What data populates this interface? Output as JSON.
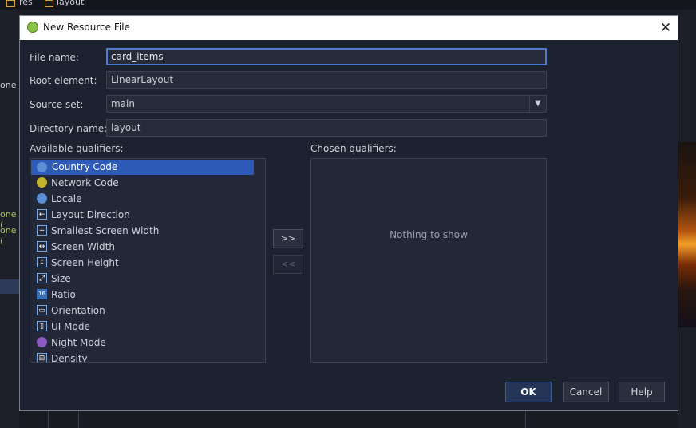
{
  "ide": {
    "breadcrumb": [
      "res",
      "layout"
    ],
    "left_fragments": [
      "one",
      "one (",
      "one ("
    ]
  },
  "dialog": {
    "title": "New Resource File",
    "close_glyph": "✕",
    "fields": {
      "file_name": {
        "label": "File name:",
        "value": "card_items"
      },
      "root_element": {
        "label": "Root element:",
        "value": "LinearLayout"
      },
      "source_set": {
        "label": "Source set:",
        "value": "main"
      },
      "directory_name": {
        "label": "Directory name:",
        "value": "layout"
      }
    },
    "available_label": "Available qualifiers:",
    "chosen_label": "Chosen qualifiers:",
    "available_qualifiers": [
      {
        "label": "Country Code",
        "icon": "globe-icon",
        "selected": true
      },
      {
        "label": "Network Code",
        "icon": "network-icon"
      },
      {
        "label": "Locale",
        "icon": "globe-icon"
      },
      {
        "label": "Layout Direction",
        "icon": "direction-icon"
      },
      {
        "label": "Smallest Screen Width",
        "icon": "resize-icon"
      },
      {
        "label": "Screen Width",
        "icon": "width-icon"
      },
      {
        "label": "Screen Height",
        "icon": "height-icon"
      },
      {
        "label": "Size",
        "icon": "size-icon"
      },
      {
        "label": "Ratio",
        "icon": "ratio-icon"
      },
      {
        "label": "Orientation",
        "icon": "orientation-icon"
      },
      {
        "label": "UI Mode",
        "icon": "ui-mode-icon"
      },
      {
        "label": "Night Mode",
        "icon": "night-mode-icon"
      },
      {
        "label": "Density",
        "icon": "density-icon"
      }
    ],
    "add_button": ">>",
    "remove_button": "<<",
    "chosen_empty": "Nothing to show",
    "buttons": {
      "ok": "OK",
      "cancel": "Cancel",
      "help": "Help"
    }
  },
  "colors": {
    "accent": "#2e5ab8",
    "focus": "#4f7bc9",
    "background": "#1d2230"
  }
}
